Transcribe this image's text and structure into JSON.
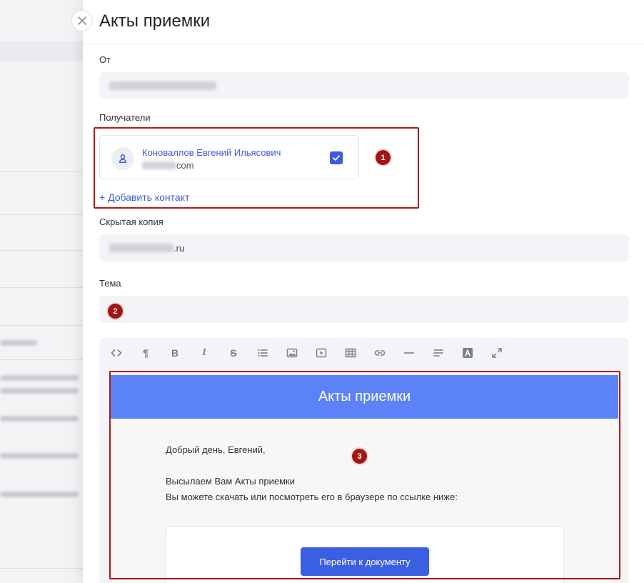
{
  "drawer": {
    "title": "Акты приемки",
    "close_icon": "close-icon"
  },
  "from": {
    "label": "От",
    "value_suffix": ""
  },
  "recipients": {
    "label": "Получатели",
    "items": [
      {
        "name": "Коноваллов Евгений Ильясович",
        "email_suffix": "com",
        "checked": true
      }
    ],
    "add_label": "+ Добавить контакт"
  },
  "bcc": {
    "label": "Скрытая копия",
    "value_suffix": ".ru"
  },
  "subject": {
    "label": "Тема",
    "value": ""
  },
  "toolbar": {
    "buttons": [
      "code-icon",
      "paragraph-icon",
      "bold-icon",
      "italic-icon",
      "strikethrough-icon",
      "list-icon",
      "image-icon",
      "video-icon",
      "table-icon",
      "link-icon",
      "horizontal-rule-icon",
      "align-icon",
      "font-color-icon",
      "fullscreen-icon"
    ],
    "bold": "B",
    "italic": "I",
    "strike": "S",
    "paragraph": "¶"
  },
  "email": {
    "header": "Акты приемки",
    "greeting": "Добрый день, Евгений,",
    "line1": "Высылаем Вам Акты приемки",
    "line2": "Вы можете скачать или посмотреть его в браузере по ссылке ниже:",
    "button": "Перейти к документу"
  },
  "markers": {
    "m1": "1",
    "m2": "2",
    "m3": "3"
  },
  "colors": {
    "accent": "#3b5bdb",
    "annotation": "#b01818",
    "email_header": "#5c82f7"
  }
}
